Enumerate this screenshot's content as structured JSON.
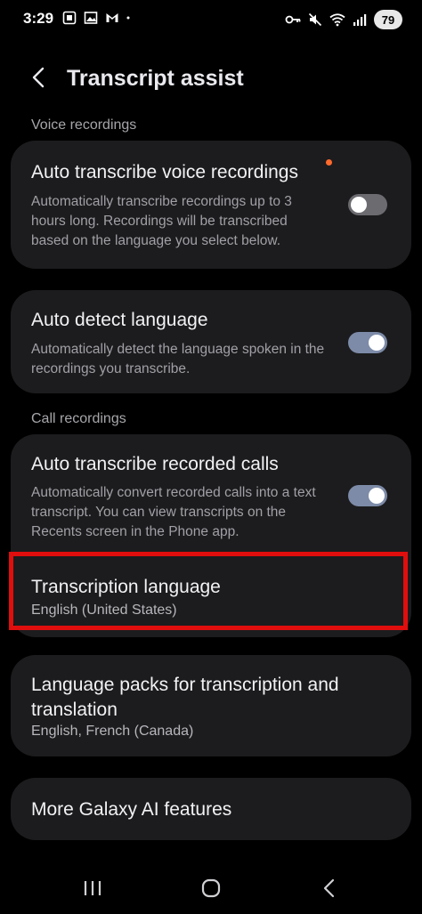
{
  "status_bar": {
    "time": "3:29",
    "battery": "79",
    "left_icons": [
      "screenshot-icon",
      "gallery-icon",
      "gmail-icon",
      "dot-icon"
    ],
    "right_icons": [
      "key-icon",
      "mute-icon",
      "wifi-icon",
      "signal-icon"
    ]
  },
  "header": {
    "title": "Transcript assist"
  },
  "sections": {
    "voice": "Voice recordings",
    "calls": "Call recordings"
  },
  "settings": {
    "auto_transcribe_voice": {
      "title": "Auto transcribe voice recordings",
      "description": "Automatically transcribe recordings up to 3 hours long. Recordings will be transcribed based on the language you select below.",
      "enabled": false
    },
    "auto_detect": {
      "title": "Auto detect language",
      "description": "Automatically detect the language spoken in the recordings you transcribe.",
      "enabled": true
    },
    "auto_transcribe_calls": {
      "title": "Auto transcribe recorded calls",
      "description": "Automatically convert recorded calls into a text transcript. You can view transcripts on the Recents screen in the Phone app.",
      "enabled": true
    },
    "transcription_language": {
      "title": "Transcription language",
      "value": "English (United States)"
    },
    "language_packs": {
      "title": "Language packs for transcription and translation",
      "value": "English, French (Canada)"
    },
    "more_ai": {
      "title": "More Galaxy AI features"
    }
  },
  "colors": {
    "background": "#000000",
    "card": "#1c1c1e",
    "toggle_on": "#7d8ba8",
    "toggle_off": "#6b6b70",
    "highlight": "#e10e0e",
    "badge_dot": "#ff6a2c"
  },
  "nav_icons": [
    "recents-icon",
    "home-icon",
    "back-icon"
  ]
}
